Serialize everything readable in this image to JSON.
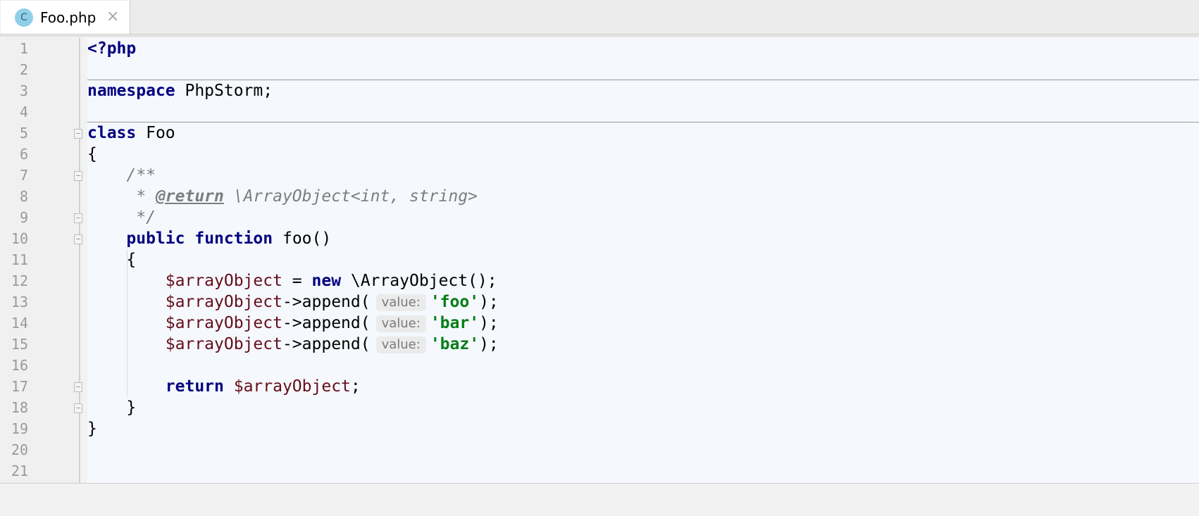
{
  "tab": {
    "icon_letter": "C",
    "filename": "Foo.php",
    "close_glyph": "×"
  },
  "colors": {
    "keyword": "#000080",
    "variable": "#660e1a",
    "string": "#067d17",
    "comment": "#7d7d7d",
    "editor_bg": "#f5f8fd",
    "tab_icon_bg": "#8fcfe8"
  },
  "line_numbers": [
    "1",
    "2",
    "3",
    "4",
    "5",
    "6",
    "7",
    "8",
    "9",
    "10",
    "11",
    "12",
    "13",
    "14",
    "15",
    "16",
    "17",
    "18",
    "19",
    "20",
    "21"
  ],
  "code": {
    "l1": "<?php",
    "l3_kw": "namespace",
    "l3_rest": " PhpStorm;",
    "l5_kw": "class",
    "l5_rest": " Foo",
    "l6": "{",
    "l7": "    /**",
    "l8_a": "     * ",
    "l8_tag": "@return",
    "l8_b": " \\ArrayObject<int, string>",
    "l9": "     */",
    "l10_ind": "    ",
    "l10_kw1": "public",
    "l10_sp": " ",
    "l10_kw2": "function",
    "l10_rest": " foo()",
    "l11": "    {",
    "l12_ind": "        ",
    "l12_var": "$arrayObject",
    "l12_mid": " = ",
    "l12_kw": "new",
    "l12_rest": " \\ArrayObject();",
    "append_var": "$arrayObject",
    "append_call": "->append(",
    "hint_label": "value:",
    "l13_str": "'foo'",
    "l14_str": "'bar'",
    "l15_str": "'baz'",
    "append_end": ");",
    "l17_ind": "        ",
    "l17_kw": "return",
    "l17_var": " $arrayObject",
    "l17_end": ";",
    "l18": "    }",
    "l19": "}"
  }
}
